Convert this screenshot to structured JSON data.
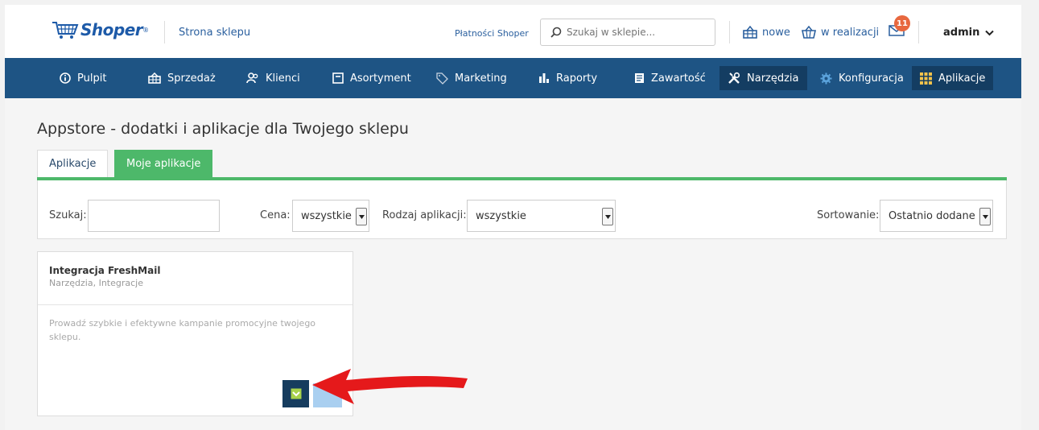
{
  "header": {
    "logo_text": "Shoper",
    "store_link": "Strona sklepu",
    "payments_link": "Płatności Shoper",
    "search_placeholder": "Szukaj w sklepie...",
    "orders_new_label": "nowe",
    "orders_processing_label": "w realizacji",
    "messages_badge": "11",
    "user_name": "admin"
  },
  "nav": {
    "items": [
      {
        "label": "Pulpit",
        "icon": "info-circle-icon"
      },
      {
        "label": "Sprzedaż",
        "icon": "basket-icon"
      },
      {
        "label": "Klienci",
        "icon": "users-icon"
      },
      {
        "label": "Asortyment",
        "icon": "box-icon"
      },
      {
        "label": "Marketing",
        "icon": "tag-icon"
      },
      {
        "label": "Raporty",
        "icon": "bar-chart-icon"
      },
      {
        "label": "Zawartość",
        "icon": "document-icon"
      },
      {
        "label": "Narzędzia",
        "icon": "tools-icon",
        "active": true
      },
      {
        "label": "Konfiguracja",
        "icon": "gear-icon"
      },
      {
        "label": "Aplikacje",
        "icon": "grid-icon",
        "active": true
      }
    ]
  },
  "page": {
    "title": "Appstore - dodatki i aplikacje dla Twojego sklepu",
    "tabs": [
      "Aplikacje",
      "Moje aplikacje"
    ],
    "active_tab": "Moje aplikacje"
  },
  "filters": {
    "search_label": "Szukaj:",
    "search_value": "",
    "price_label": "Cena:",
    "price_value": "wszystkie",
    "type_label": "Rodzaj aplikacji:",
    "type_value": "wszystkie",
    "sort_label": "Sortowanie:",
    "sort_value": "Ostatnio dodane"
  },
  "apps": [
    {
      "title": "Integracja FreshMail",
      "categories": "Narzędzia, Integracje",
      "description": "Prowadź szybkie i efektywne kampanie promocyjne twojego sklepu."
    }
  ],
  "colors": {
    "nav_bg": "#1e5484",
    "nav_active": "#143d62",
    "accent_green": "#4db86a",
    "annotation_arrow": "#e5191b"
  }
}
